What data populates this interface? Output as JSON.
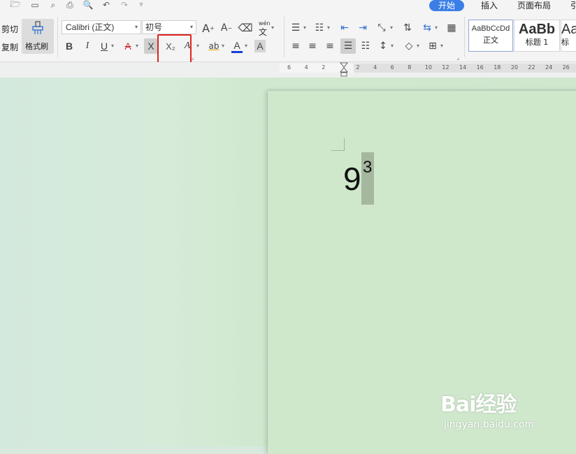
{
  "quick_access": {
    "icons": [
      "open-folder-icon",
      "save-icon",
      "paste-format-icon",
      "print-icon",
      "print-preview-icon",
      "undo-icon",
      "redo-icon",
      "more-icon"
    ]
  },
  "tabs": {
    "start": "开始",
    "insert": "插入",
    "page_layout": "页面布局",
    "more": "引"
  },
  "clipboard": {
    "cut": "剪切",
    "copy": "复制",
    "format_painter": "格式刷"
  },
  "font": {
    "name": "Calibri (正文)",
    "size": "初号",
    "pinyin": "wén"
  },
  "buttons": {
    "bold": "B",
    "italic": "I",
    "underline": "U",
    "strikethrough": "A",
    "superscript": "X",
    "subscript": "X₂",
    "text_effect": "A",
    "highlight": "ab",
    "font_color": "A",
    "char_shade": "A",
    "grow": "A",
    "shrink": "A"
  },
  "styles": [
    {
      "sample": "AaBbCcDd",
      "name": "正文"
    },
    {
      "sample": "AaBb",
      "name": "标题 1"
    },
    {
      "sample": "AaB",
      "name": "标"
    }
  ],
  "ruler": {
    "ticks": [
      "6",
      "4",
      "2",
      "",
      "2",
      "4",
      "6",
      "8",
      "10",
      "12",
      "14",
      "16",
      "18",
      "20",
      "22",
      "24",
      "26"
    ]
  },
  "document": {
    "base": "9",
    "superscript": "3"
  },
  "watermark": {
    "brand": "Bai经验",
    "url": "jingyan.baidu.com"
  },
  "colors": {
    "accent": "#3b7fe6",
    "highlight_box": "#e0231f",
    "page_bg": "#cfe8cc",
    "selection": "#a5b79f"
  }
}
